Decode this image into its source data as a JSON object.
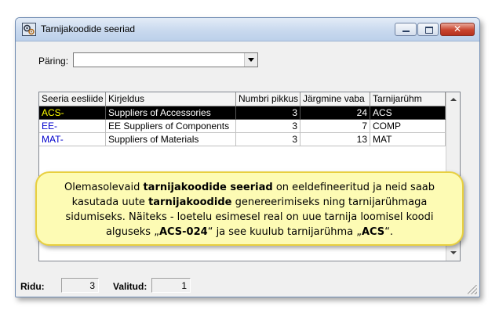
{
  "window": {
    "title": "Tarnijakoodide seeriad"
  },
  "query": {
    "label": "Päring:",
    "value": ""
  },
  "table": {
    "columns": [
      "Seeria eesliide",
      "Kirjeldus",
      "Numbri pikkus",
      "Järgmine vaba",
      "Tarnijarühm"
    ],
    "rows": [
      {
        "prefix": "ACS-",
        "description": "Suppliers of Accessories",
        "length": "3",
        "next": "24",
        "group": "ACS",
        "selected": true
      },
      {
        "prefix": "EE-",
        "description": "EE Suppliers of Components",
        "length": "3",
        "next": "7",
        "group": "COMP",
        "selected": false
      },
      {
        "prefix": "MAT-",
        "description": "Suppliers of Materials",
        "length": "3",
        "next": "13",
        "group": "MAT",
        "selected": false
      }
    ]
  },
  "note": {
    "p1": "Olemasolevaid ",
    "b1": "tarnijakoodide  seeriad",
    "p2": " on eeldefineeritud ja neid saab kasutada uute ",
    "b2": "tarnijakoodide",
    "p3": "  genereerimiseks ning tarnijarühmaga sidumiseks. Näiteks - loetelu esimesel real on uue tarnija loomisel koodi alguseks „",
    "b3": "ACS-024",
    "p4": "“ ja see kuulub tarnijarühma „",
    "b4": "ACS",
    "p5": "“."
  },
  "status": {
    "rows_label": "Ridu:",
    "rows_value": "3",
    "selected_label": "Valitud:",
    "selected_value": "1"
  },
  "colors": {
    "selected_row_bg": "#000000",
    "selected_prefix": "#ffff00",
    "prefix": "#0000cc",
    "note_bg": "#fdfbb4",
    "note_border": "#e8cf3f"
  }
}
